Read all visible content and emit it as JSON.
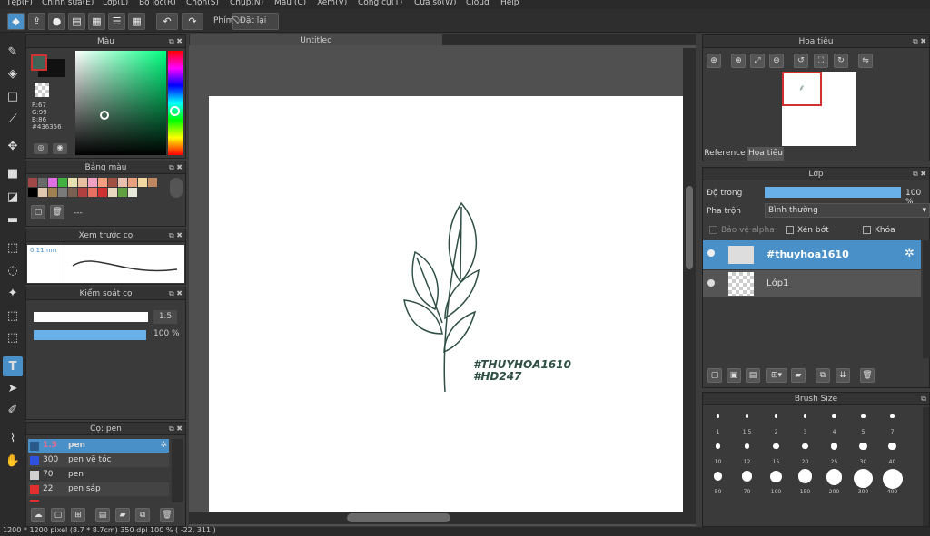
{
  "menu": [
    "Tệp(F)",
    "Chỉnh sửa(E)",
    "Lớp(L)",
    "Bộ lọc(R)",
    "Chọn(S)",
    "Chụp(N)",
    "Màu (C)",
    "Xem(V)",
    "Công cụ(T)",
    "Cửa sổ(W)",
    "Cloud",
    "Help"
  ],
  "toolbar": {
    "phim_label": "Phím",
    "reset_label": "Đặt lại"
  },
  "color_panel": {
    "title": "Màu",
    "r": "R:67",
    "g": "G:99",
    "b": "B:86",
    "hex": "#436356",
    "main_color": "#436356"
  },
  "palette_panel": {
    "title": "Bảng màu",
    "value": "---",
    "swatches": [
      "#a04848",
      "#6a6a6a",
      "#e070e0",
      "#40b040",
      "#e8e0b0",
      "#e8c0a0",
      "#f0a0c0",
      "#f7a080",
      "#a05040",
      "#e8c0b0",
      "#e8a080",
      "#f0d8a0",
      "#c08860",
      "#000000",
      "#e0c8b0",
      "#a08050",
      "#7a7a7a",
      "#7a6050",
      "#b04040",
      "#e87060",
      "#d03030",
      "#e8d8c0",
      "#60a040",
      "#e8e8d8"
    ]
  },
  "brush_preview": {
    "title": "Xem trước cọ",
    "size": "0.11mm"
  },
  "brush_control": {
    "title": "Kiểm soát cọ",
    "size": "1.5",
    "opacity": "100 %"
  },
  "brush_list": {
    "title": "Cọ: pen",
    "items": [
      {
        "size": "1.5",
        "name": "pen",
        "color": "#2a5a8a"
      },
      {
        "size": "300",
        "name": "pen vẽ tóc",
        "color": "#3050e0"
      },
      {
        "size": "70",
        "name": "pen",
        "color": "#d0d0d0"
      },
      {
        "size": "22",
        "name": "pen sáp",
        "color": "#e03030"
      },
      {
        "size": "",
        "name": "",
        "color": "#e03030"
      }
    ]
  },
  "canvas": {
    "tab": "Untitled",
    "text_line1": "#THUYHOA1610",
    "text_line2": "#HD247"
  },
  "navigator": {
    "title": "Hoa tiêu",
    "tab_reference": "Reference",
    "tab_navigator": "Hoa tiêu"
  },
  "layers": {
    "title": "Lớp",
    "opacity_label": "Độ trong",
    "opacity_value": "100 %",
    "opacity_fill": 1.0,
    "blend_label": "Pha trộn",
    "blend_value": "Bình thường",
    "protect_alpha": "Bảo vệ alpha",
    "clipping": "Xén bớt",
    "lock": "Khóa",
    "items": [
      {
        "name": "#thuyhoa1610"
      },
      {
        "name": "Lớp1"
      }
    ]
  },
  "brush_size": {
    "title": "Brush Size",
    "sizes": [
      "1",
      "1.5",
      "2",
      "3",
      "4",
      "5",
      "7",
      "10",
      "12",
      "15",
      "20",
      "25",
      "30",
      "40",
      "50",
      "70",
      "100",
      "150",
      "200",
      "300",
      "400"
    ]
  },
  "status": {
    "text": "1200 * 1200 pixel  (8.7 * 8.7cm)  350 dpi  100 %  ( -22, 311 )"
  }
}
